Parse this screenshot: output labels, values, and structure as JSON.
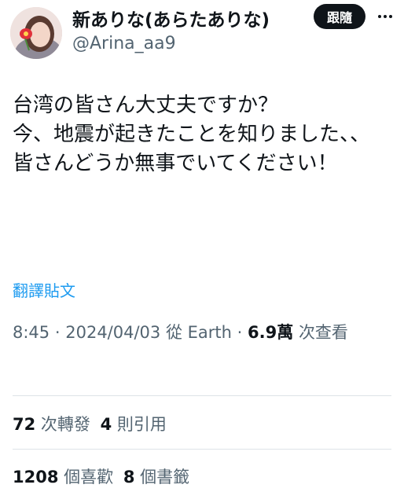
{
  "header": {
    "display_name": "新ありな(あらたありな)",
    "handle": "@Arina_aa9",
    "follow_label": "跟隨",
    "more_icon": "ellipsis-icon"
  },
  "post": {
    "text": "台湾の皆さん大丈夫ですか？\n今、地震が起きたことを知りました、、\n皆さんどうか無事でいてください！",
    "translate_label": "翻譯貼文",
    "time": "8:45",
    "date": "2024/04/03",
    "from_label": "從",
    "source": "Earth",
    "views_count": "6.9萬",
    "views_label": "次查看",
    "separator": "·"
  },
  "stats": {
    "reposts_count": "72",
    "reposts_label": "次轉發",
    "quotes_count": "4",
    "quotes_label": "則引用",
    "likes_count": "1208",
    "likes_label": "個喜歡",
    "bookmarks_count": "8",
    "bookmarks_label": "個書籤"
  }
}
